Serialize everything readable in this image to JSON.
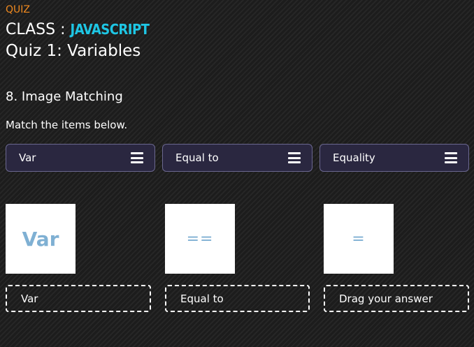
{
  "header": {
    "section_label": "QUIZ",
    "class_prefix": "CLASS : ",
    "class_subject": "JAVASCRIPT",
    "quiz_title": "Quiz 1: Variables"
  },
  "question": {
    "title": "8. Image Matching",
    "instructions": "Match the items below."
  },
  "drag_items": [
    {
      "label": "Var",
      "icon": "drag-handle-icon"
    },
    {
      "label": "Equal to",
      "icon": "drag-handle-icon"
    },
    {
      "label": "Equality",
      "icon": "drag-handle-icon"
    }
  ],
  "image_tiles": [
    {
      "text": "Var"
    },
    {
      "text": "=="
    },
    {
      "text": "="
    }
  ],
  "drop_zones": [
    {
      "value": "Var"
    },
    {
      "value": "Equal to"
    },
    {
      "value": "Drag your answer"
    }
  ],
  "colors": {
    "accent_orange": "#f0891e",
    "subject_cyan": "#1ec6e4",
    "drag_item_bg": "#2a2740",
    "tile_text": "#7fb0d3"
  }
}
